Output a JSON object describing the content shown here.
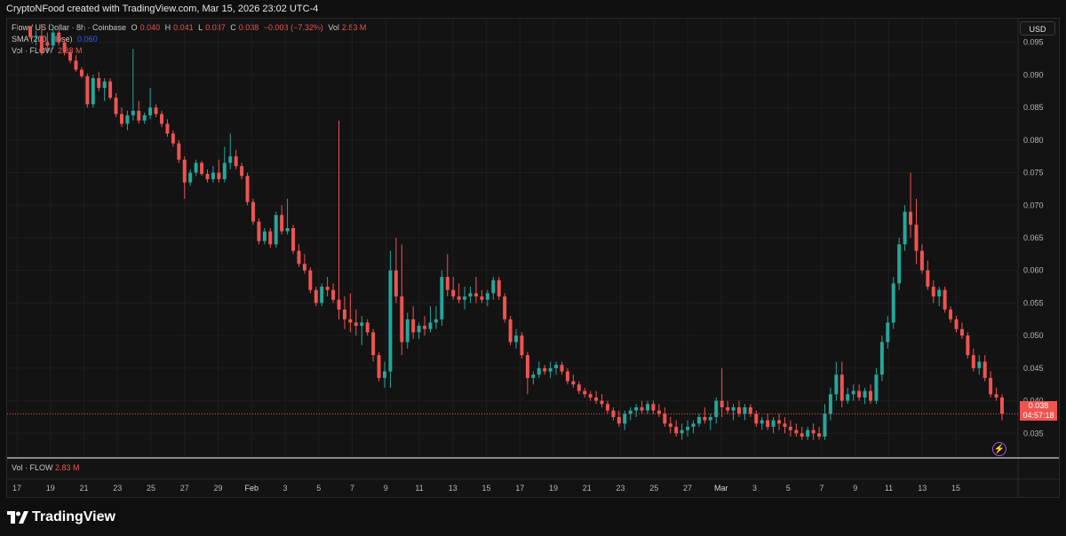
{
  "credit": "CryptoNFood created with TradingView.com, Mar 15, 2026 23:02 UTC-4",
  "legend": {
    "symbol": "Flow / US Dollar · 8h · Coinbase",
    "o_label": "O",
    "o_value": "0.040",
    "h_label": "H",
    "h_value": "0.041",
    "l_label": "L",
    "l_value": "0.037",
    "c_label": "C",
    "c_value": "0.038",
    "change": "−0.003 (−7.32%)",
    "vol_label": "Vol",
    "vol_value": "2.83 M",
    "sma_label": "SMA (200, close)",
    "sma_value": "0.060",
    "vol_flow_label": "Vol · FLOW",
    "vol_flow_value": "2.83 M"
  },
  "volume_pane": {
    "label": "Vol · FLOW",
    "value": "2.83 M"
  },
  "currency_button": "USD",
  "price_tag": {
    "price": "0.038",
    "countdown": "04:57:18"
  },
  "footer": {
    "brand": "TradingView",
    "logo_icon": "tradingview-logo-icon"
  },
  "colors": {
    "up": "#26a69a",
    "down": "#ef5350",
    "background": "#131313",
    "grid": "#1e1e1e",
    "text": "#b2b5be"
  },
  "chart_data": {
    "type": "candlestick",
    "title": "Flow / US Dollar · 8h · Coinbase",
    "xlabel": "",
    "ylabel": "USD",
    "ylim": [
      0.0315,
      0.0985
    ],
    "y_ticks": [
      "0.095",
      "0.090",
      "0.085",
      "0.080",
      "0.075",
      "0.070",
      "0.065",
      "0.060",
      "0.055",
      "0.050",
      "0.045",
      "0.040",
      "0.035"
    ],
    "x_ticks": [
      "17",
      "19",
      "21",
      "23",
      "25",
      "27",
      "29",
      "Feb",
      "3",
      "5",
      "7",
      "9",
      "11",
      "13",
      "15",
      "17",
      "19",
      "21",
      "23",
      "25",
      "27",
      "Mar",
      "3",
      "5",
      "7",
      "9",
      "11",
      "13",
      "15"
    ],
    "current_price": 0.038,
    "grid": true,
    "series": [
      {
        "values": [
          [
            0.0975,
            0.0975,
            0.0955,
            0.0958
          ],
          [
            0.0958,
            0.0968,
            0.0945,
            0.096
          ],
          [
            0.096,
            0.0978,
            0.093,
            0.0935
          ],
          [
            0.095,
            0.0965,
            0.0935,
            0.0945
          ],
          [
            0.0945,
            0.0975,
            0.094,
            0.0965
          ],
          [
            0.0965,
            0.0968,
            0.0945,
            0.095
          ],
          [
            0.095,
            0.0955,
            0.093,
            0.0935
          ],
          [
            0.0935,
            0.094,
            0.0918,
            0.0922
          ],
          [
            0.0922,
            0.093,
            0.0905,
            0.0908
          ],
          [
            0.0908,
            0.0912,
            0.0895,
            0.0898
          ],
          [
            0.0898,
            0.0902,
            0.085,
            0.0855
          ],
          [
            0.0855,
            0.09,
            0.085,
            0.0895
          ],
          [
            0.0895,
            0.0905,
            0.0875,
            0.088
          ],
          [
            0.088,
            0.0895,
            0.086,
            0.089
          ],
          [
            0.089,
            0.0895,
            0.0862,
            0.0865
          ],
          [
            0.0865,
            0.0872,
            0.0835,
            0.084
          ],
          [
            0.084,
            0.085,
            0.082,
            0.0825
          ],
          [
            0.0825,
            0.0845,
            0.0815,
            0.0838
          ],
          [
            0.0838,
            0.094,
            0.083,
            0.0845
          ],
          [
            0.0845,
            0.086,
            0.0825,
            0.083
          ],
          [
            0.083,
            0.0842,
            0.0825,
            0.0838
          ],
          [
            0.0838,
            0.088,
            0.0832,
            0.085
          ],
          [
            0.085,
            0.0855,
            0.0835,
            0.084
          ],
          [
            0.084,
            0.0845,
            0.082,
            0.0825
          ],
          [
            0.0825,
            0.0832,
            0.0805,
            0.081
          ],
          [
            0.081,
            0.0815,
            0.079,
            0.0795
          ],
          [
            0.0795,
            0.08,
            0.0765,
            0.077
          ],
          [
            0.077,
            0.0775,
            0.071,
            0.0735
          ],
          [
            0.0735,
            0.0755,
            0.073,
            0.075
          ],
          [
            0.075,
            0.077,
            0.0745,
            0.0765
          ],
          [
            0.0765,
            0.0768,
            0.0745,
            0.0748
          ],
          [
            0.0748,
            0.0755,
            0.0735,
            0.074
          ],
          [
            0.074,
            0.076,
            0.0735,
            0.075
          ],
          [
            0.075,
            0.077,
            0.0735,
            0.074
          ],
          [
            0.074,
            0.079,
            0.0735,
            0.0765
          ],
          [
            0.0765,
            0.081,
            0.0755,
            0.0775
          ],
          [
            0.0775,
            0.0785,
            0.0755,
            0.076
          ],
          [
            0.076,
            0.0765,
            0.074,
            0.0745
          ],
          [
            0.0745,
            0.075,
            0.07,
            0.0705
          ],
          [
            0.0705,
            0.071,
            0.067,
            0.0675
          ],
          [
            0.0675,
            0.068,
            0.064,
            0.0645
          ],
          [
            0.0645,
            0.0665,
            0.064,
            0.066
          ],
          [
            0.066,
            0.0665,
            0.0635,
            0.064
          ],
          [
            0.064,
            0.069,
            0.0635,
            0.0685
          ],
          [
            0.0685,
            0.07,
            0.0655,
            0.066
          ],
          [
            0.066,
            0.071,
            0.0655,
            0.0665
          ],
          [
            0.0665,
            0.067,
            0.0625,
            0.063
          ],
          [
            0.063,
            0.064,
            0.0605,
            0.061
          ],
          [
            0.061,
            0.0625,
            0.0595,
            0.06
          ],
          [
            0.06,
            0.0605,
            0.0565,
            0.057
          ],
          [
            0.057,
            0.0575,
            0.0545,
            0.055
          ],
          [
            0.055,
            0.058,
            0.0545,
            0.0575
          ],
          [
            0.0575,
            0.059,
            0.056,
            0.057
          ],
          [
            0.057,
            0.058,
            0.055,
            0.0555
          ],
          [
            0.0555,
            0.083,
            0.0525,
            0.054
          ],
          [
            0.054,
            0.056,
            0.051,
            0.0525
          ],
          [
            0.0525,
            0.0565,
            0.0505,
            0.052
          ],
          [
            0.052,
            0.054,
            0.05,
            0.0515
          ],
          [
            0.0515,
            0.053,
            0.0485,
            0.052
          ],
          [
            0.052,
            0.0525,
            0.05,
            0.0505
          ],
          [
            0.0505,
            0.051,
            0.046,
            0.047
          ],
          [
            0.047,
            0.0475,
            0.043,
            0.0435
          ],
          [
            0.0435,
            0.046,
            0.042,
            0.0445
          ],
          [
            0.0445,
            0.063,
            0.042,
            0.06
          ],
          [
            0.06,
            0.065,
            0.055,
            0.056
          ],
          [
            0.056,
            0.064,
            0.047,
            0.049
          ],
          [
            0.049,
            0.0535,
            0.048,
            0.0525
          ],
          [
            0.0525,
            0.0545,
            0.0495,
            0.0505
          ],
          [
            0.0505,
            0.052,
            0.0495,
            0.0515
          ],
          [
            0.0515,
            0.053,
            0.05,
            0.051
          ],
          [
            0.051,
            0.0545,
            0.0505,
            0.052
          ],
          [
            0.052,
            0.0545,
            0.051,
            0.0525
          ],
          [
            0.0525,
            0.06,
            0.0515,
            0.059
          ],
          [
            0.059,
            0.0625,
            0.056,
            0.057
          ],
          [
            0.057,
            0.059,
            0.0555,
            0.056
          ],
          [
            0.056,
            0.058,
            0.055,
            0.0555
          ],
          [
            0.0555,
            0.0575,
            0.054,
            0.056
          ],
          [
            0.056,
            0.0575,
            0.055,
            0.0565
          ],
          [
            0.0565,
            0.059,
            0.055,
            0.056
          ],
          [
            0.056,
            0.057,
            0.055,
            0.0555
          ],
          [
            0.0555,
            0.057,
            0.0545,
            0.0565
          ],
          [
            0.0565,
            0.059,
            0.0555,
            0.0585
          ],
          [
            0.0585,
            0.059,
            0.0555,
            0.056
          ],
          [
            0.056,
            0.0565,
            0.052,
            0.0525
          ],
          [
            0.0525,
            0.053,
            0.0485,
            0.049
          ],
          [
            0.049,
            0.051,
            0.048,
            0.05
          ],
          [
            0.05,
            0.0505,
            0.0465,
            0.047
          ],
          [
            0.047,
            0.0475,
            0.041,
            0.0435
          ],
          [
            0.0435,
            0.0445,
            0.0425,
            0.044
          ],
          [
            0.044,
            0.046,
            0.0435,
            0.045
          ],
          [
            0.045,
            0.0455,
            0.044,
            0.0445
          ],
          [
            0.0445,
            0.046,
            0.0435,
            0.045
          ],
          [
            0.045,
            0.046,
            0.044,
            0.0455
          ],
          [
            0.0455,
            0.046,
            0.044,
            0.0445
          ],
          [
            0.0445,
            0.045,
            0.0425,
            0.043
          ],
          [
            0.043,
            0.044,
            0.042,
            0.0425
          ],
          [
            0.0425,
            0.043,
            0.041,
            0.0415
          ],
          [
            0.0415,
            0.042,
            0.0405,
            0.041
          ],
          [
            0.041,
            0.0415,
            0.04,
            0.0405
          ],
          [
            0.0405,
            0.0415,
            0.0395,
            0.04
          ],
          [
            0.04,
            0.041,
            0.039,
            0.0395
          ],
          [
            0.0395,
            0.04,
            0.038,
            0.0385
          ],
          [
            0.0385,
            0.039,
            0.037,
            0.0375
          ],
          [
            0.0375,
            0.0385,
            0.036,
            0.0365
          ],
          [
            0.0365,
            0.0385,
            0.0355,
            0.038
          ],
          [
            0.038,
            0.039,
            0.037,
            0.0385
          ],
          [
            0.0385,
            0.0395,
            0.0375,
            0.039
          ],
          [
            0.039,
            0.04,
            0.038,
            0.0385
          ],
          [
            0.0385,
            0.04,
            0.038,
            0.0395
          ],
          [
            0.0395,
            0.04,
            0.038,
            0.0385
          ],
          [
            0.0385,
            0.0395,
            0.0375,
            0.038
          ],
          [
            0.038,
            0.039,
            0.036,
            0.0365
          ],
          [
            0.0365,
            0.0375,
            0.035,
            0.036
          ],
          [
            0.036,
            0.037,
            0.0345,
            0.035
          ],
          [
            0.035,
            0.0365,
            0.034,
            0.0355
          ],
          [
            0.0355,
            0.037,
            0.0345,
            0.036
          ],
          [
            0.036,
            0.037,
            0.035,
            0.0365
          ],
          [
            0.0365,
            0.038,
            0.036,
            0.0375
          ],
          [
            0.0375,
            0.039,
            0.0365,
            0.037
          ],
          [
            0.037,
            0.038,
            0.0355,
            0.0375
          ],
          [
            0.0375,
            0.0405,
            0.0365,
            0.04
          ],
          [
            0.04,
            0.045,
            0.0375,
            0.039
          ],
          [
            0.039,
            0.04,
            0.038,
            0.0385
          ],
          [
            0.0385,
            0.0395,
            0.037,
            0.039
          ],
          [
            0.039,
            0.04,
            0.0375,
            0.038
          ],
          [
            0.038,
            0.0395,
            0.037,
            0.039
          ],
          [
            0.039,
            0.0395,
            0.0375,
            0.038
          ],
          [
            0.038,
            0.0385,
            0.036,
            0.0365
          ],
          [
            0.0365,
            0.0375,
            0.0355,
            0.037
          ],
          [
            0.037,
            0.038,
            0.0355,
            0.036
          ],
          [
            0.036,
            0.0375,
            0.035,
            0.037
          ],
          [
            0.037,
            0.038,
            0.0355,
            0.0365
          ],
          [
            0.0365,
            0.0375,
            0.035,
            0.036
          ],
          [
            0.036,
            0.037,
            0.0345,
            0.0355
          ],
          [
            0.0355,
            0.0365,
            0.0345,
            0.035
          ],
          [
            0.035,
            0.036,
            0.034,
            0.0345
          ],
          [
            0.0345,
            0.036,
            0.034,
            0.0355
          ],
          [
            0.0355,
            0.0365,
            0.034,
            0.035
          ],
          [
            0.035,
            0.036,
            0.034,
            0.0345
          ],
          [
            0.0345,
            0.0395,
            0.034,
            0.038
          ],
          [
            0.038,
            0.042,
            0.037,
            0.041
          ],
          [
            0.041,
            0.046,
            0.04,
            0.044
          ],
          [
            0.044,
            0.046,
            0.039,
            0.04
          ],
          [
            0.04,
            0.042,
            0.0395,
            0.041
          ],
          [
            0.041,
            0.0425,
            0.04,
            0.0415
          ],
          [
            0.0415,
            0.0425,
            0.04,
            0.0405
          ],
          [
            0.0405,
            0.042,
            0.0395,
            0.0415
          ],
          [
            0.0415,
            0.0425,
            0.0395,
            0.04
          ],
          [
            0.04,
            0.045,
            0.0395,
            0.044
          ],
          [
            0.044,
            0.05,
            0.043,
            0.049
          ],
          [
            0.049,
            0.053,
            0.048,
            0.052
          ],
          [
            0.052,
            0.059,
            0.051,
            0.058
          ],
          [
            0.058,
            0.065,
            0.057,
            0.064
          ],
          [
            0.064,
            0.07,
            0.063,
            0.069
          ],
          [
            0.069,
            0.075,
            0.065,
            0.067
          ],
          [
            0.067,
            0.071,
            0.061,
            0.063
          ],
          [
            0.063,
            0.064,
            0.0595,
            0.06
          ],
          [
            0.06,
            0.0615,
            0.057,
            0.0575
          ],
          [
            0.0575,
            0.0585,
            0.055,
            0.056
          ],
          [
            0.056,
            0.0575,
            0.0545,
            0.057
          ],
          [
            0.057,
            0.0575,
            0.0535,
            0.054
          ],
          [
            0.054,
            0.0545,
            0.052,
            0.0525
          ],
          [
            0.0525,
            0.053,
            0.0505,
            0.051
          ],
          [
            0.051,
            0.052,
            0.0495,
            0.05
          ],
          [
            0.05,
            0.0505,
            0.0465,
            0.047
          ],
          [
            0.047,
            0.048,
            0.0445,
            0.045
          ],
          [
            0.045,
            0.047,
            0.044,
            0.046
          ],
          [
            0.046,
            0.047,
            0.043,
            0.0435
          ],
          [
            0.0435,
            0.0445,
            0.0405,
            0.041
          ],
          [
            0.041,
            0.042,
            0.04,
            0.0405
          ],
          [
            0.0405,
            0.041,
            0.037,
            0.038
          ]
        ]
      }
    ]
  }
}
